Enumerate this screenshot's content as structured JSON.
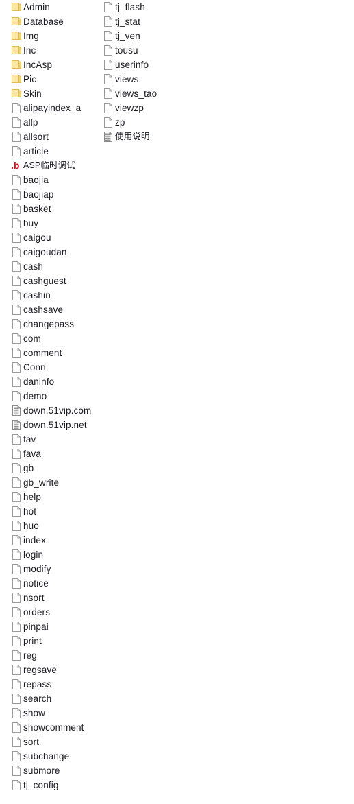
{
  "window": {
    "title": "File Listing",
    "background_color": "#ffffff",
    "text_color": "#1a1a22"
  },
  "icons": {
    "folder": {
      "name": "folder-icon",
      "fill": "#fce8a5",
      "tab": "#f2d06b",
      "stroke": "#e3bc4e"
    },
    "file": {
      "name": "file-icon",
      "fill": "#ffffff",
      "stroke": "#9a9a9a"
    },
    "text_document": {
      "name": "text-document-icon",
      "fill": "#ffffff",
      "stroke": "#8a8a8a",
      "lines": "#7a7a7a"
    },
    "asp_debug": {
      "name": "asp-debug-icon",
      "glyph": ".b",
      "color": "#d8121a"
    }
  },
  "columns": [
    {
      "name": "left-column",
      "items": [
        {
          "label": "Admin",
          "icon": "folder"
        },
        {
          "label": "Database",
          "icon": "folder"
        },
        {
          "label": "Img",
          "icon": "folder"
        },
        {
          "label": "Inc",
          "icon": "folder"
        },
        {
          "label": "IncAsp",
          "icon": "folder"
        },
        {
          "label": "Pic",
          "icon": "folder"
        },
        {
          "label": "Skin",
          "icon": "folder"
        },
        {
          "label": "alipayindex_a",
          "icon": "file"
        },
        {
          "label": "allp",
          "icon": "file"
        },
        {
          "label": "allsort",
          "icon": "file"
        },
        {
          "label": "article",
          "icon": "file"
        },
        {
          "label": "ASP临时调试",
          "icon": "asp_debug",
          "cjk": true
        },
        {
          "label": "baojia",
          "icon": "file"
        },
        {
          "label": "baojiap",
          "icon": "file"
        },
        {
          "label": "basket",
          "icon": "file"
        },
        {
          "label": "buy",
          "icon": "file"
        },
        {
          "label": "caigou",
          "icon": "file"
        },
        {
          "label": "caigoudan",
          "icon": "file"
        },
        {
          "label": "cash",
          "icon": "file"
        },
        {
          "label": "cashguest",
          "icon": "file"
        },
        {
          "label": "cashin",
          "icon": "file"
        },
        {
          "label": "cashsave",
          "icon": "file"
        },
        {
          "label": "changepass",
          "icon": "file"
        },
        {
          "label": "com",
          "icon": "file"
        },
        {
          "label": "comment",
          "icon": "file"
        },
        {
          "label": "Conn",
          "icon": "file"
        },
        {
          "label": "daninfo",
          "icon": "file"
        },
        {
          "label": "demo",
          "icon": "file"
        },
        {
          "label": "down.51vip.com",
          "icon": "text_document"
        },
        {
          "label": "down.51vip.net",
          "icon": "text_document"
        },
        {
          "label": "fav",
          "icon": "file"
        },
        {
          "label": "fava",
          "icon": "file"
        },
        {
          "label": "gb",
          "icon": "file"
        },
        {
          "label": "gb_write",
          "icon": "file"
        },
        {
          "label": "help",
          "icon": "file"
        },
        {
          "label": "hot",
          "icon": "file"
        },
        {
          "label": "huo",
          "icon": "file"
        },
        {
          "label": "index",
          "icon": "file"
        },
        {
          "label": "login",
          "icon": "file"
        },
        {
          "label": "modify",
          "icon": "file"
        },
        {
          "label": "notice",
          "icon": "file"
        },
        {
          "label": "nsort",
          "icon": "file"
        },
        {
          "label": "orders",
          "icon": "file"
        },
        {
          "label": "pinpai",
          "icon": "file"
        },
        {
          "label": "print",
          "icon": "file"
        },
        {
          "label": "reg",
          "icon": "file"
        },
        {
          "label": "regsave",
          "icon": "file"
        },
        {
          "label": "repass",
          "icon": "file"
        },
        {
          "label": "search",
          "icon": "file"
        },
        {
          "label": "show",
          "icon": "file"
        },
        {
          "label": "showcomment",
          "icon": "file"
        },
        {
          "label": "sort",
          "icon": "file"
        },
        {
          "label": "subchange",
          "icon": "file"
        },
        {
          "label": "submore",
          "icon": "file"
        },
        {
          "label": "tj_config",
          "icon": "file"
        }
      ]
    },
    {
      "name": "right-column",
      "items": [
        {
          "label": "tj_flash",
          "icon": "file"
        },
        {
          "label": "tj_stat",
          "icon": "file"
        },
        {
          "label": "tj_ven",
          "icon": "file"
        },
        {
          "label": "tousu",
          "icon": "file"
        },
        {
          "label": "userinfo",
          "icon": "file"
        },
        {
          "label": "views",
          "icon": "file"
        },
        {
          "label": "views_tao",
          "icon": "file"
        },
        {
          "label": "viewzp",
          "icon": "file"
        },
        {
          "label": "zp",
          "icon": "file"
        },
        {
          "label": "使用说明",
          "icon": "text_document",
          "cjk": true
        }
      ]
    }
  ]
}
